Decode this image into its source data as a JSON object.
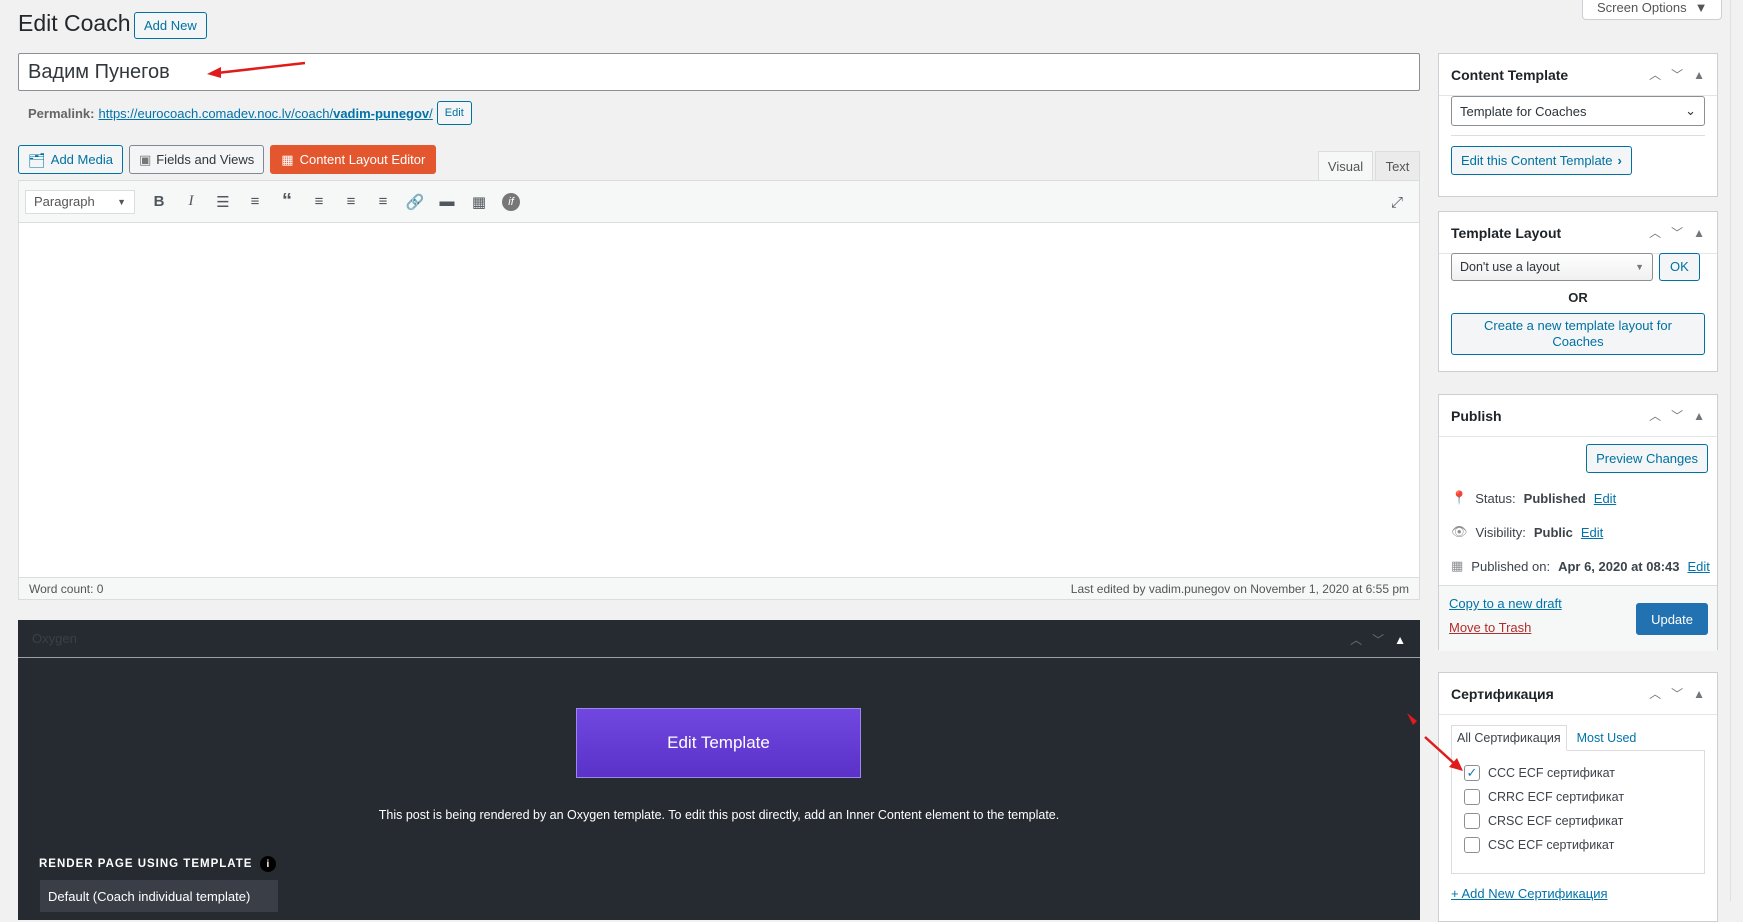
{
  "header": {
    "title": "Edit Coach",
    "add_new": "Add New",
    "screen_options": "Screen Options"
  },
  "post": {
    "title_value": "Вадим Пунегов"
  },
  "permalink": {
    "label": "Permalink:",
    "url_prefix": "https://eurocoach.comadev.noc.lv/coach/",
    "slug": "vadim-punegov",
    "suffix": "/",
    "edit": "Edit"
  },
  "media": {
    "add_media": "Add Media",
    "fields_views": "Fields and Views",
    "content_layout_editor": "Content Layout Editor"
  },
  "editor": {
    "tab_visual": "Visual",
    "tab_text": "Text",
    "format": "Paragraph",
    "word_count": "Word count: 0",
    "last_edited": "Last edited by vadim.punegov on November 1, 2020 at 6:55 pm"
  },
  "oxygen": {
    "box_title": "Oxygen",
    "edit_template": "Edit Template",
    "note": "This post is being rendered by an Oxygen template. To edit this post directly, add an Inner Content element to the template.",
    "render_label": "RENDER PAGE USING TEMPLATE",
    "render_value": "Default (Coach individual template)"
  },
  "content_template": {
    "title": "Content Template",
    "selected": "Template for Coaches",
    "edit_button": "Edit this Content Template"
  },
  "template_layout": {
    "title": "Template Layout",
    "selected": "Don't use a layout",
    "ok": "OK",
    "or": "OR",
    "create_button": "Create a new template layout for Coaches"
  },
  "publish": {
    "title": "Publish",
    "preview": "Preview Changes",
    "status_label": "Status:",
    "status_value": "Published",
    "visibility_label": "Visibility:",
    "visibility_value": "Public",
    "published_label": "Published on:",
    "published_value": "Apr 6, 2020 at 08:43",
    "edit": "Edit",
    "copy_draft": "Copy to a new draft",
    "trash": "Move to Trash",
    "update": "Update"
  },
  "certification": {
    "title": "Сертификация",
    "tab_all": "All Сертификация",
    "tab_most_used": "Most Used",
    "items": [
      {
        "label": "CCC ECF сертификат",
        "checked": true
      },
      {
        "label": "CRRC ECF сертификат",
        "checked": false
      },
      {
        "label": "CRSC ECF сертификат",
        "checked": false
      },
      {
        "label": "CSC ECF сертификат",
        "checked": false
      }
    ],
    "add_new": "+ Add New Сертификация"
  },
  "colors": {
    "link": "#0073aa",
    "primary": "#2271b1",
    "orange": "#e4562e",
    "oxygen_bg": "#262a31",
    "purple": "#6a42da",
    "trash": "#b32d2e",
    "annotation": "#e01b1b"
  }
}
